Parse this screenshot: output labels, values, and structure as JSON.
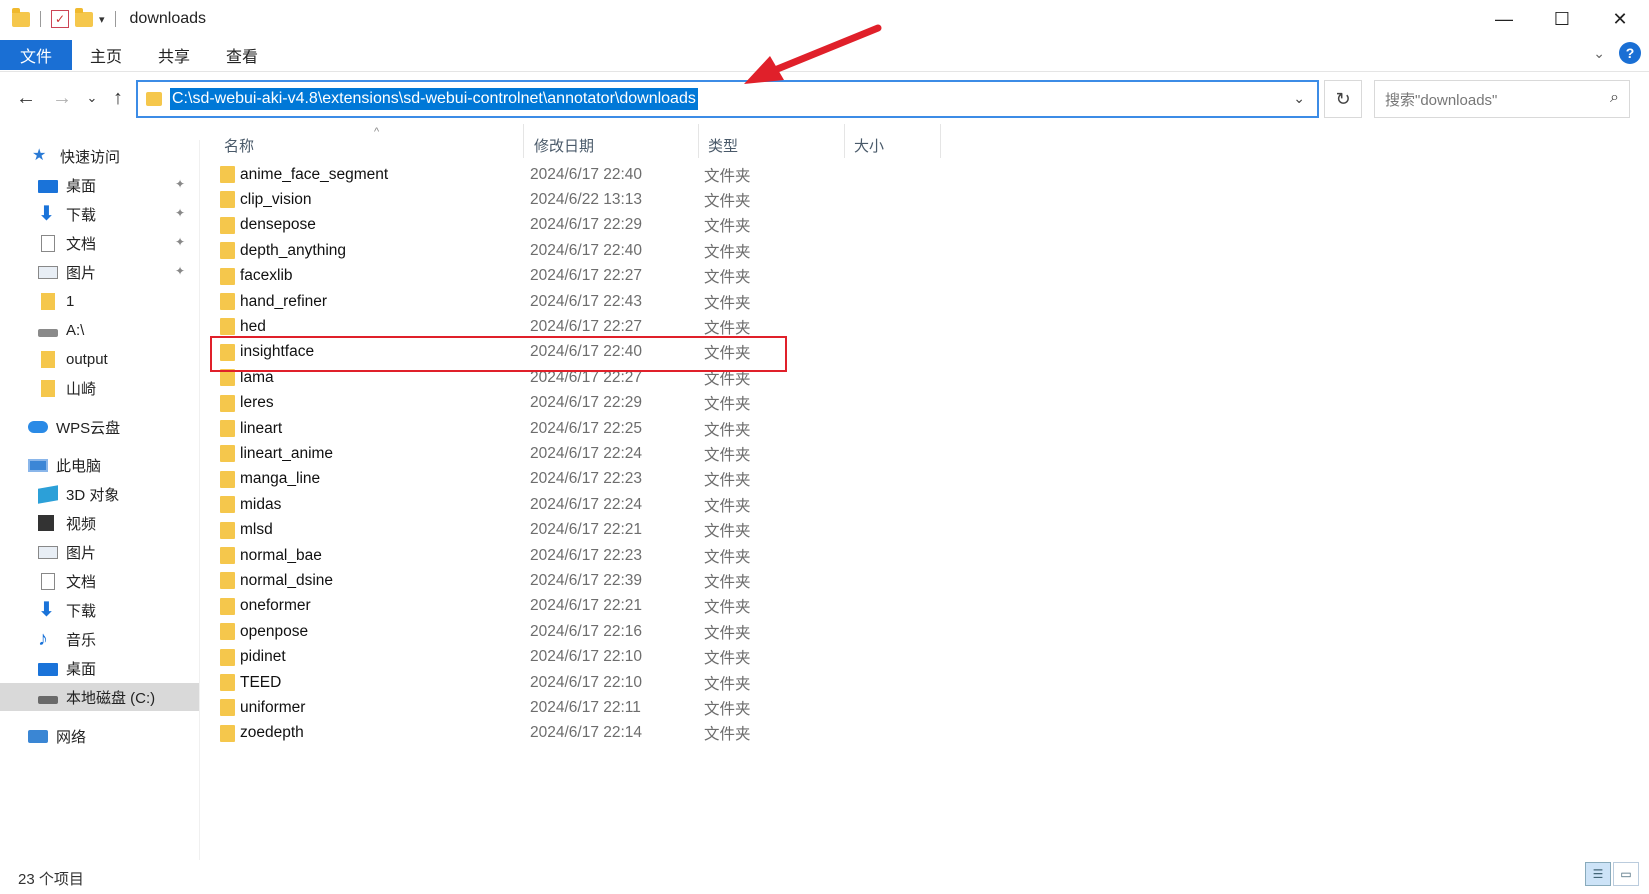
{
  "window": {
    "title": "downloads",
    "controls": {
      "minimize": "—",
      "maximize": "☐",
      "close": "✕"
    }
  },
  "quick_access_toolbar": {
    "properties_glyph": "✓",
    "dropdown_glyph": "▾"
  },
  "ribbon": {
    "tabs": [
      "文件",
      "主页",
      "共享",
      "查看"
    ],
    "collapse_glyph": "⌄",
    "help_glyph": "?"
  },
  "nav_buttons": {
    "back": "←",
    "forward": "→",
    "recent": "⌄",
    "up": "↑"
  },
  "address": {
    "path": "C:\\sd-webui-aki-v4.8\\extensions\\sd-webui-controlnet\\annotator\\downloads",
    "dropdown_glyph": "⌄",
    "refresh_glyph": "↻"
  },
  "search": {
    "placeholder": "搜索\"downloads\"",
    "icon_glyph": "⌕"
  },
  "sidebar": {
    "items": [
      {
        "label": "快速访问",
        "icon": "star-icon",
        "pinned": false
      },
      {
        "label": "桌面",
        "icon": "desktop-icon",
        "pinned": true
      },
      {
        "label": "下载",
        "icon": "download-icon",
        "pinned": true
      },
      {
        "label": "文档",
        "icon": "document-icon",
        "pinned": true
      },
      {
        "label": "图片",
        "icon": "pictures-icon",
        "pinned": true
      },
      {
        "label": "1",
        "icon": "folder-icon",
        "pinned": false
      },
      {
        "label": "A:\\",
        "icon": "drive-icon",
        "pinned": false
      },
      {
        "label": "output",
        "icon": "folder-icon",
        "pinned": false
      },
      {
        "label": "山崎",
        "icon": "folder-icon",
        "pinned": false
      },
      {
        "label": "WPS云盘",
        "icon": "cloud-icon",
        "pinned": false
      },
      {
        "label": "此电脑",
        "icon": "computer-icon",
        "pinned": false
      },
      {
        "label": "3D 对象",
        "icon": "3d-objects-icon",
        "pinned": false
      },
      {
        "label": "视频",
        "icon": "video-icon",
        "pinned": false
      },
      {
        "label": "图片",
        "icon": "pictures-icon",
        "pinned": false
      },
      {
        "label": "文档",
        "icon": "document-icon",
        "pinned": false
      },
      {
        "label": "下载",
        "icon": "download-icon",
        "pinned": false
      },
      {
        "label": "音乐",
        "icon": "music-icon",
        "pinned": false
      },
      {
        "label": "桌面",
        "icon": "desktop-icon",
        "pinned": false
      },
      {
        "label": "本地磁盘 (C:)",
        "icon": "local-disk-icon",
        "pinned": false
      },
      {
        "label": "网络",
        "icon": "network-icon",
        "pinned": false
      }
    ],
    "pin_glyph": "📌"
  },
  "columns": {
    "name": "名称",
    "modified": "修改日期",
    "type": "类型",
    "size": "大小",
    "sort_glyph": "^"
  },
  "files": [
    {
      "name": "anime_face_segment",
      "date": "2024/6/17 22:40",
      "type": "文件夹"
    },
    {
      "name": "clip_vision",
      "date": "2024/6/22 13:13",
      "type": "文件夹"
    },
    {
      "name": "densepose",
      "date": "2024/6/17 22:29",
      "type": "文件夹"
    },
    {
      "name": "depth_anything",
      "date": "2024/6/17 22:40",
      "type": "文件夹"
    },
    {
      "name": "facexlib",
      "date": "2024/6/17 22:27",
      "type": "文件夹"
    },
    {
      "name": "hand_refiner",
      "date": "2024/6/17 22:43",
      "type": "文件夹"
    },
    {
      "name": "hed",
      "date": "2024/6/17 22:27",
      "type": "文件夹"
    },
    {
      "name": "insightface",
      "date": "2024/6/17 22:40",
      "type": "文件夹"
    },
    {
      "name": "lama",
      "date": "2024/6/17 22:27",
      "type": "文件夹"
    },
    {
      "name": "leres",
      "date": "2024/6/17 22:29",
      "type": "文件夹"
    },
    {
      "name": "lineart",
      "date": "2024/6/17 22:25",
      "type": "文件夹"
    },
    {
      "name": "lineart_anime",
      "date": "2024/6/17 22:24",
      "type": "文件夹"
    },
    {
      "name": "manga_line",
      "date": "2024/6/17 22:23",
      "type": "文件夹"
    },
    {
      "name": "midas",
      "date": "2024/6/17 22:24",
      "type": "文件夹"
    },
    {
      "name": "mlsd",
      "date": "2024/6/17 22:21",
      "type": "文件夹"
    },
    {
      "name": "normal_bae",
      "date": "2024/6/17 22:23",
      "type": "文件夹"
    },
    {
      "name": "normal_dsine",
      "date": "2024/6/17 22:39",
      "type": "文件夹"
    },
    {
      "name": "oneformer",
      "date": "2024/6/17 22:21",
      "type": "文件夹"
    },
    {
      "name": "openpose",
      "date": "2024/6/17 22:16",
      "type": "文件夹"
    },
    {
      "name": "pidinet",
      "date": "2024/6/17 22:10",
      "type": "文件夹"
    },
    {
      "name": "TEED",
      "date": "2024/6/17 22:10",
      "type": "文件夹"
    },
    {
      "name": "uniformer",
      "date": "2024/6/17 22:11",
      "type": "文件夹"
    },
    {
      "name": "zoedepth",
      "date": "2024/6/17 22:14",
      "type": "文件夹"
    }
  ],
  "status": {
    "item_count": "23 个项目"
  },
  "view_icons": {
    "details_glyph": "☰",
    "tiles_glyph": "▭"
  },
  "colors": {
    "accent": "#1a6fd4",
    "selection": "#0078d7",
    "annotation_red": "#e0202a",
    "folder": "#f5c74c"
  }
}
